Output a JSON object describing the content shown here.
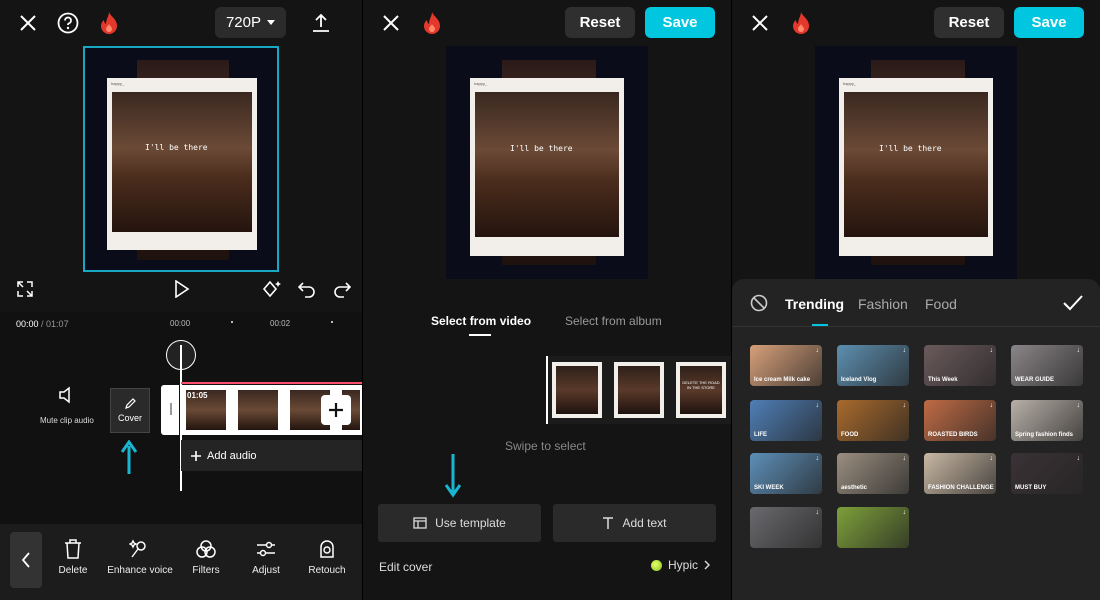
{
  "panel1": {
    "resolution": "720P",
    "preview": {
      "caption": "I'll be there",
      "account": "happy_"
    },
    "time": {
      "current": "00:00",
      "total": "/ 01:07"
    },
    "ticks": [
      "00:00",
      "00:02"
    ],
    "clip_timestamp": "01:05",
    "mute_label": "Mute clip audio",
    "cover_label": "Cover",
    "add_audio_label": "Add audio",
    "toolbar": [
      {
        "label": "Delete",
        "icon": "trash-icon"
      },
      {
        "label": "Enhance voice",
        "icon": "enhance-voice-icon"
      },
      {
        "label": "Filters",
        "icon": "filters-icon"
      },
      {
        "label": "Adjust",
        "icon": "adjust-icon"
      },
      {
        "label": "Retouch",
        "icon": "retouch-icon"
      }
    ]
  },
  "panel2": {
    "reset_label": "Reset",
    "save_label": "Save",
    "preview": {
      "caption": "I'll be there",
      "account": "happy_"
    },
    "tabs": [
      "Select from video",
      "Select from album"
    ],
    "active_tab": "Select from video",
    "frame_caption": "DELETE THE ROAD IN THE STORE",
    "swipe_hint": "Swipe to select",
    "use_template_label": "Use template",
    "add_text_label": "Add text",
    "edit_cover_label": "Edit cover",
    "hypic_label": "Hypic"
  },
  "panel3": {
    "reset_label": "Reset",
    "save_label": "Save",
    "preview": {
      "caption": "I'll be there",
      "account": "happy_"
    },
    "categories": [
      "Trending",
      "Fashion",
      "Food"
    ],
    "active_category": "Trending",
    "templates": [
      {
        "text": "Ice cream Milk cake",
        "bg": "#d7a07a"
      },
      {
        "text": "Iceland Vlog",
        "bg": "#5d8fb0"
      },
      {
        "text": "This Week",
        "bg": "#6b5a5c"
      },
      {
        "text": "WEAR GUIDE",
        "bg": "#8a8588"
      },
      {
        "text": "LIFE",
        "bg": "#4f7fb6"
      },
      {
        "text": "FOOD",
        "bg": "#a96a2c"
      },
      {
        "text": "ROASTED BIRDS",
        "bg": "#c06b45"
      },
      {
        "text": "Spring fashion finds",
        "bg": "#b8b0a8"
      },
      {
        "text": "SKI WEEK",
        "bg": "#5d8fb8"
      },
      {
        "text": "aesthetic",
        "bg": "#9a8e80"
      },
      {
        "text": "FASHION CHALLENGE",
        "bg": "#c9b8a4"
      },
      {
        "text": "MUST BUY",
        "bg": "#3a3236"
      },
      {
        "text": "",
        "bg": "#6a6a6e"
      },
      {
        "text": "",
        "bg": "#7da03a"
      }
    ]
  },
  "colors": {
    "accent": "#00c6e0",
    "brand_flame": "#e5382d",
    "panel_bg": "#141414",
    "sheet_bg": "#232323"
  }
}
